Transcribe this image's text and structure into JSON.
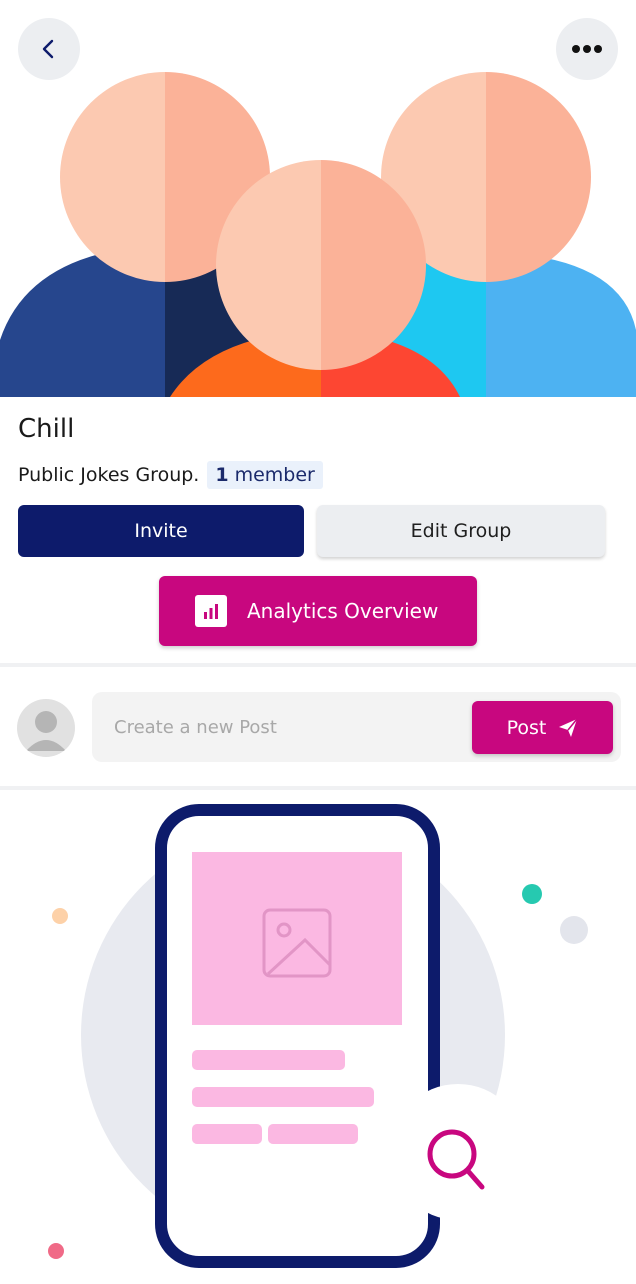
{
  "header": {
    "back_icon": "chevron-left-icon",
    "more_icon": "more-horizontal-icon"
  },
  "group": {
    "name": "Chill",
    "description": "Public Jokes Group.",
    "member_count": "1",
    "member_label": "member"
  },
  "actions": {
    "invite_label": "Invite",
    "edit_label": "Edit Group",
    "analytics_label": "Analytics Overview",
    "analytics_icon": "bar-chart-icon"
  },
  "composer": {
    "placeholder": "Create a new Post",
    "post_label": "Post",
    "send_icon": "paper-plane-icon",
    "avatar_icon": "user-avatar-icon"
  },
  "colors": {
    "primary_navy": "#0d1b6b",
    "accent_magenta": "#c8077f",
    "secondary_gray": "#eceef1"
  }
}
